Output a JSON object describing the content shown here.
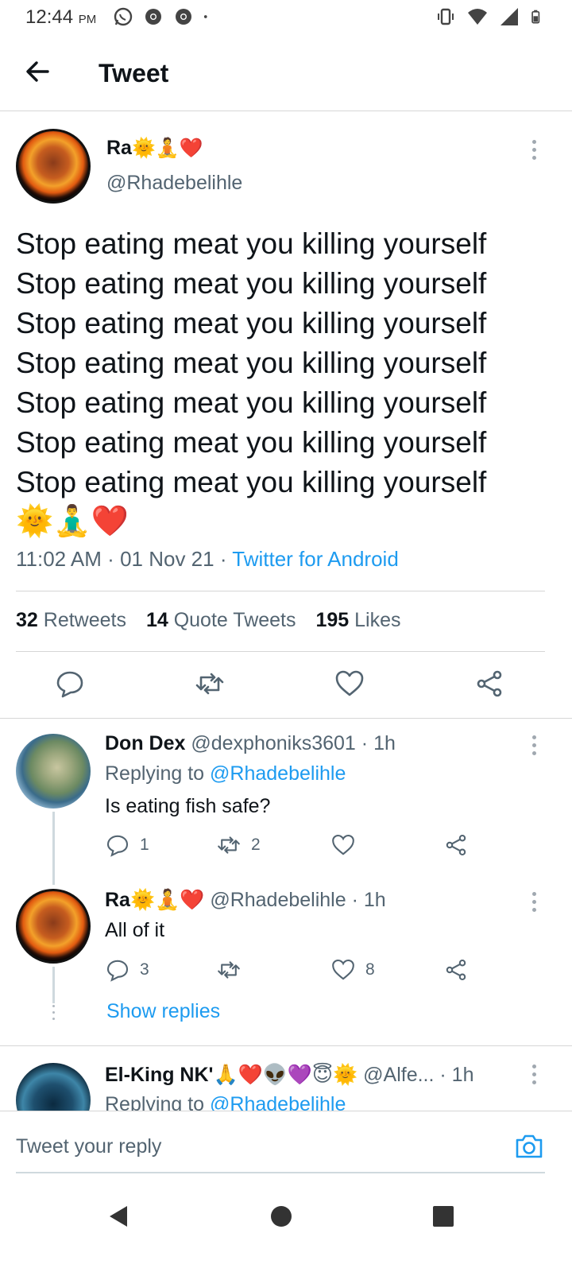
{
  "status_bar": {
    "time": "12:44",
    "ampm": "PM",
    "icons_left": [
      "whatsapp-icon",
      "chrome-icon",
      "chrome-icon",
      "dot-icon"
    ],
    "icons_right": [
      "vibrate-icon",
      "wifi-icon",
      "signal-icon",
      "battery-icon"
    ]
  },
  "header": {
    "title": "Tweet"
  },
  "main_tweet": {
    "name": "Ra",
    "name_emoji": "🌞🧘❤️",
    "handle": "@Rhadebelihle",
    "lines": [
      "Stop eating meat you killing yourself",
      "Stop eating meat you killing yourself",
      "Stop eating meat you killing yourself",
      "Stop eating meat you killing yourself",
      "Stop eating meat you killing yourself",
      "Stop eating meat you killing yourself",
      "Stop eating meat you killing yourself"
    ],
    "emoji_line": "🌞🧘‍♂️❤️",
    "time": "11:02 AM",
    "date": "01 Nov 21",
    "source": "Twitter for Android",
    "retweets": "32",
    "retweets_label": "Retweets",
    "quotes": "14",
    "quotes_label": "Quote Tweets",
    "likes": "195",
    "likes_label": "Likes"
  },
  "replies": [
    {
      "name": "Don Dex",
      "handle": "@dexphoniks3601",
      "time": "· 1h",
      "replying_prefix": "Replying to",
      "replying_to": "@Rhadebelihle",
      "text": "Is eating fish safe?",
      "reply_count": "1",
      "retweet_count": "2",
      "like_count": ""
    },
    {
      "name": "Ra",
      "name_emoji": "🌞🧘❤️",
      "handle": "@Rhadebelihle",
      "time": "· 1h",
      "text": "All of it",
      "reply_count": "3",
      "retweet_count": "",
      "like_count": "8"
    },
    {
      "name": "El-King NK'",
      "name_emoji": "🙏❤️👽💜😇🌞",
      "handle": "@Alfe...",
      "time": "· 1h",
      "replying_prefix": "Replying to",
      "replying_to": "@Rhadebelihle"
    }
  ],
  "show_replies": "Show replies",
  "compose": {
    "placeholder": "Tweet your reply"
  },
  "colors": {
    "accent": "#1d9bf0",
    "text": "#0f1419",
    "muted": "#536471",
    "heart": "#e0245e"
  }
}
